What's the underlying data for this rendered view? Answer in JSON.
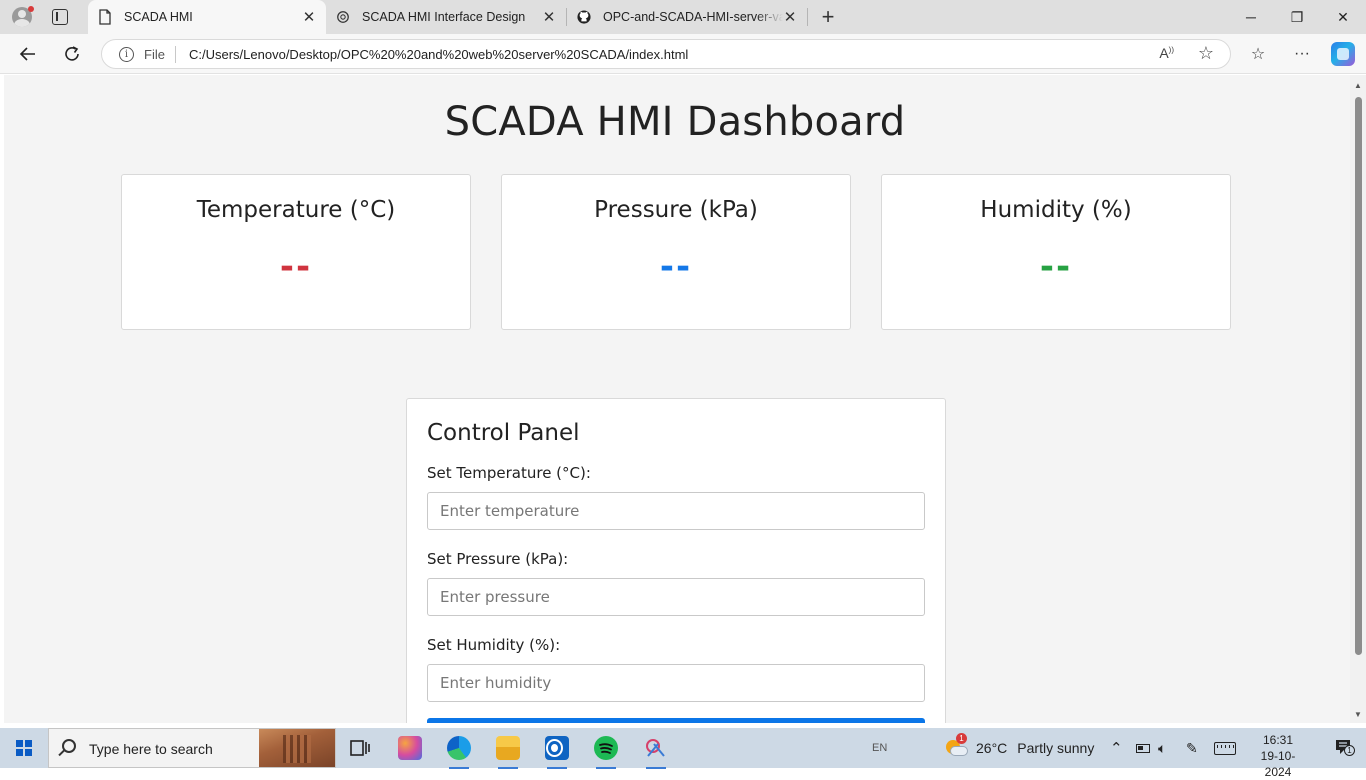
{
  "browser": {
    "tabs": [
      {
        "title": "SCADA HMI",
        "active": true
      },
      {
        "title": "SCADA HMI Interface Design",
        "active": false
      },
      {
        "title": "OPC-and-SCADA-HMI-server-vali",
        "active": false
      }
    ],
    "address": {
      "scheme_label": "File",
      "url": "C:/Users/Lenovo/Desktop/OPC%20%20and%20web%20server%20SCADA/index.html"
    }
  },
  "page": {
    "title": "SCADA HMI Dashboard",
    "cards": [
      {
        "title": "Temperature (°C)",
        "value": "--",
        "color": "#d0343f"
      },
      {
        "title": "Pressure (kPa)",
        "value": "--",
        "color": "#1478e8"
      },
      {
        "title": "Humidity (%)",
        "value": "--",
        "color": "#27a243"
      }
    ],
    "control_panel": {
      "title": "Control Panel",
      "fields": [
        {
          "label": "Set Temperature (°C):",
          "placeholder": "Enter temperature",
          "value": ""
        },
        {
          "label": "Set Pressure (kPa):",
          "placeholder": "Enter pressure",
          "value": ""
        },
        {
          "label": "Set Humidity (%):",
          "placeholder": "Enter humidity",
          "value": ""
        }
      ],
      "submit_color": "#0b76e8"
    }
  },
  "taskbar": {
    "search_placeholder": "Type here to search",
    "language": "EN",
    "weather": {
      "temperature": "26°C",
      "condition": "Partly sunny",
      "alert_count": "1"
    },
    "time": "16:31",
    "date": "19-10-2024",
    "notification_count": "1",
    "apps": [
      "task-view-icon",
      "copilot-icon",
      "edge-icon",
      "file-explorer-icon",
      "outlook-icon",
      "spotify-icon",
      "snipping-tool-icon"
    ]
  }
}
